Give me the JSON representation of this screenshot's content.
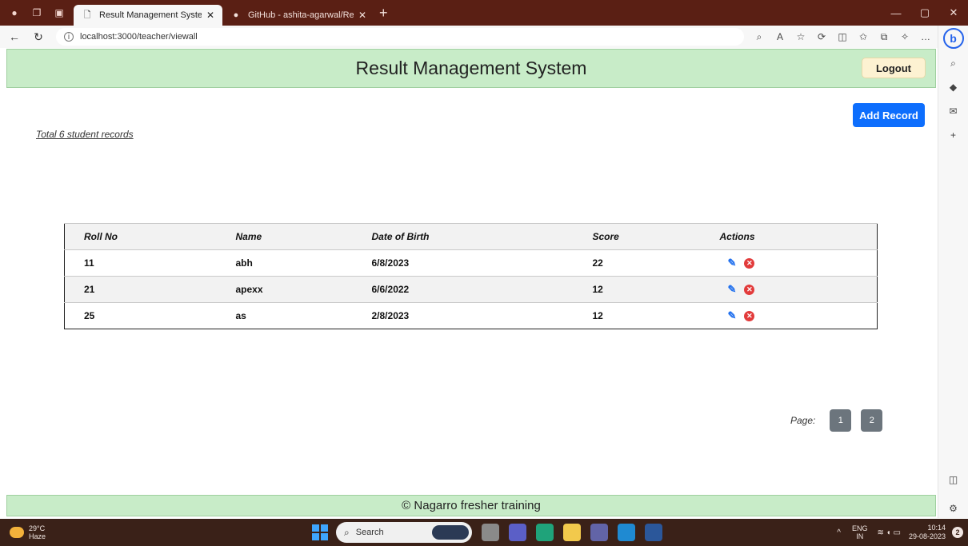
{
  "browser": {
    "tabs": [
      {
        "title": "Result Management System",
        "active": true
      },
      {
        "title": "GitHub - ashita-agarwal/Result-M",
        "active": false
      }
    ],
    "url": "localhost:3000/teacher/viewall"
  },
  "header": {
    "title": "Result Management System",
    "logout_label": "Logout"
  },
  "toolbar": {
    "add_record_label": "Add Record"
  },
  "summary": {
    "total_text": "Total 6 student records"
  },
  "table": {
    "headers": [
      "Roll No",
      "Name",
      "Date of Birth",
      "Score",
      "Actions"
    ],
    "rows": [
      {
        "roll": "11",
        "name": "abh",
        "dob": "6/8/2023",
        "score": "22"
      },
      {
        "roll": "21",
        "name": "apexx",
        "dob": "6/6/2022",
        "score": "12"
      },
      {
        "roll": "25",
        "name": "as",
        "dob": "2/8/2023",
        "score": "12"
      }
    ],
    "icons": {
      "edit": "pencil-icon",
      "delete": "delete-icon"
    }
  },
  "pagination": {
    "label": "Page:",
    "pages": [
      "1",
      "2"
    ]
  },
  "footer": {
    "text": "© Nagarro fresher training"
  },
  "taskbar": {
    "weather_temp": "29°C",
    "weather_desc": "Haze",
    "search_placeholder": "Search",
    "lang_top": "ENG",
    "lang_bottom": "IN",
    "time": "10:14",
    "date": "29-08-2023",
    "notification_count": "2"
  },
  "colors": {
    "header_bg": "#c8ecc8",
    "primary_button": "#0d6efd",
    "page_button": "#6c757d",
    "logout_bg": "#fdf2d2"
  }
}
